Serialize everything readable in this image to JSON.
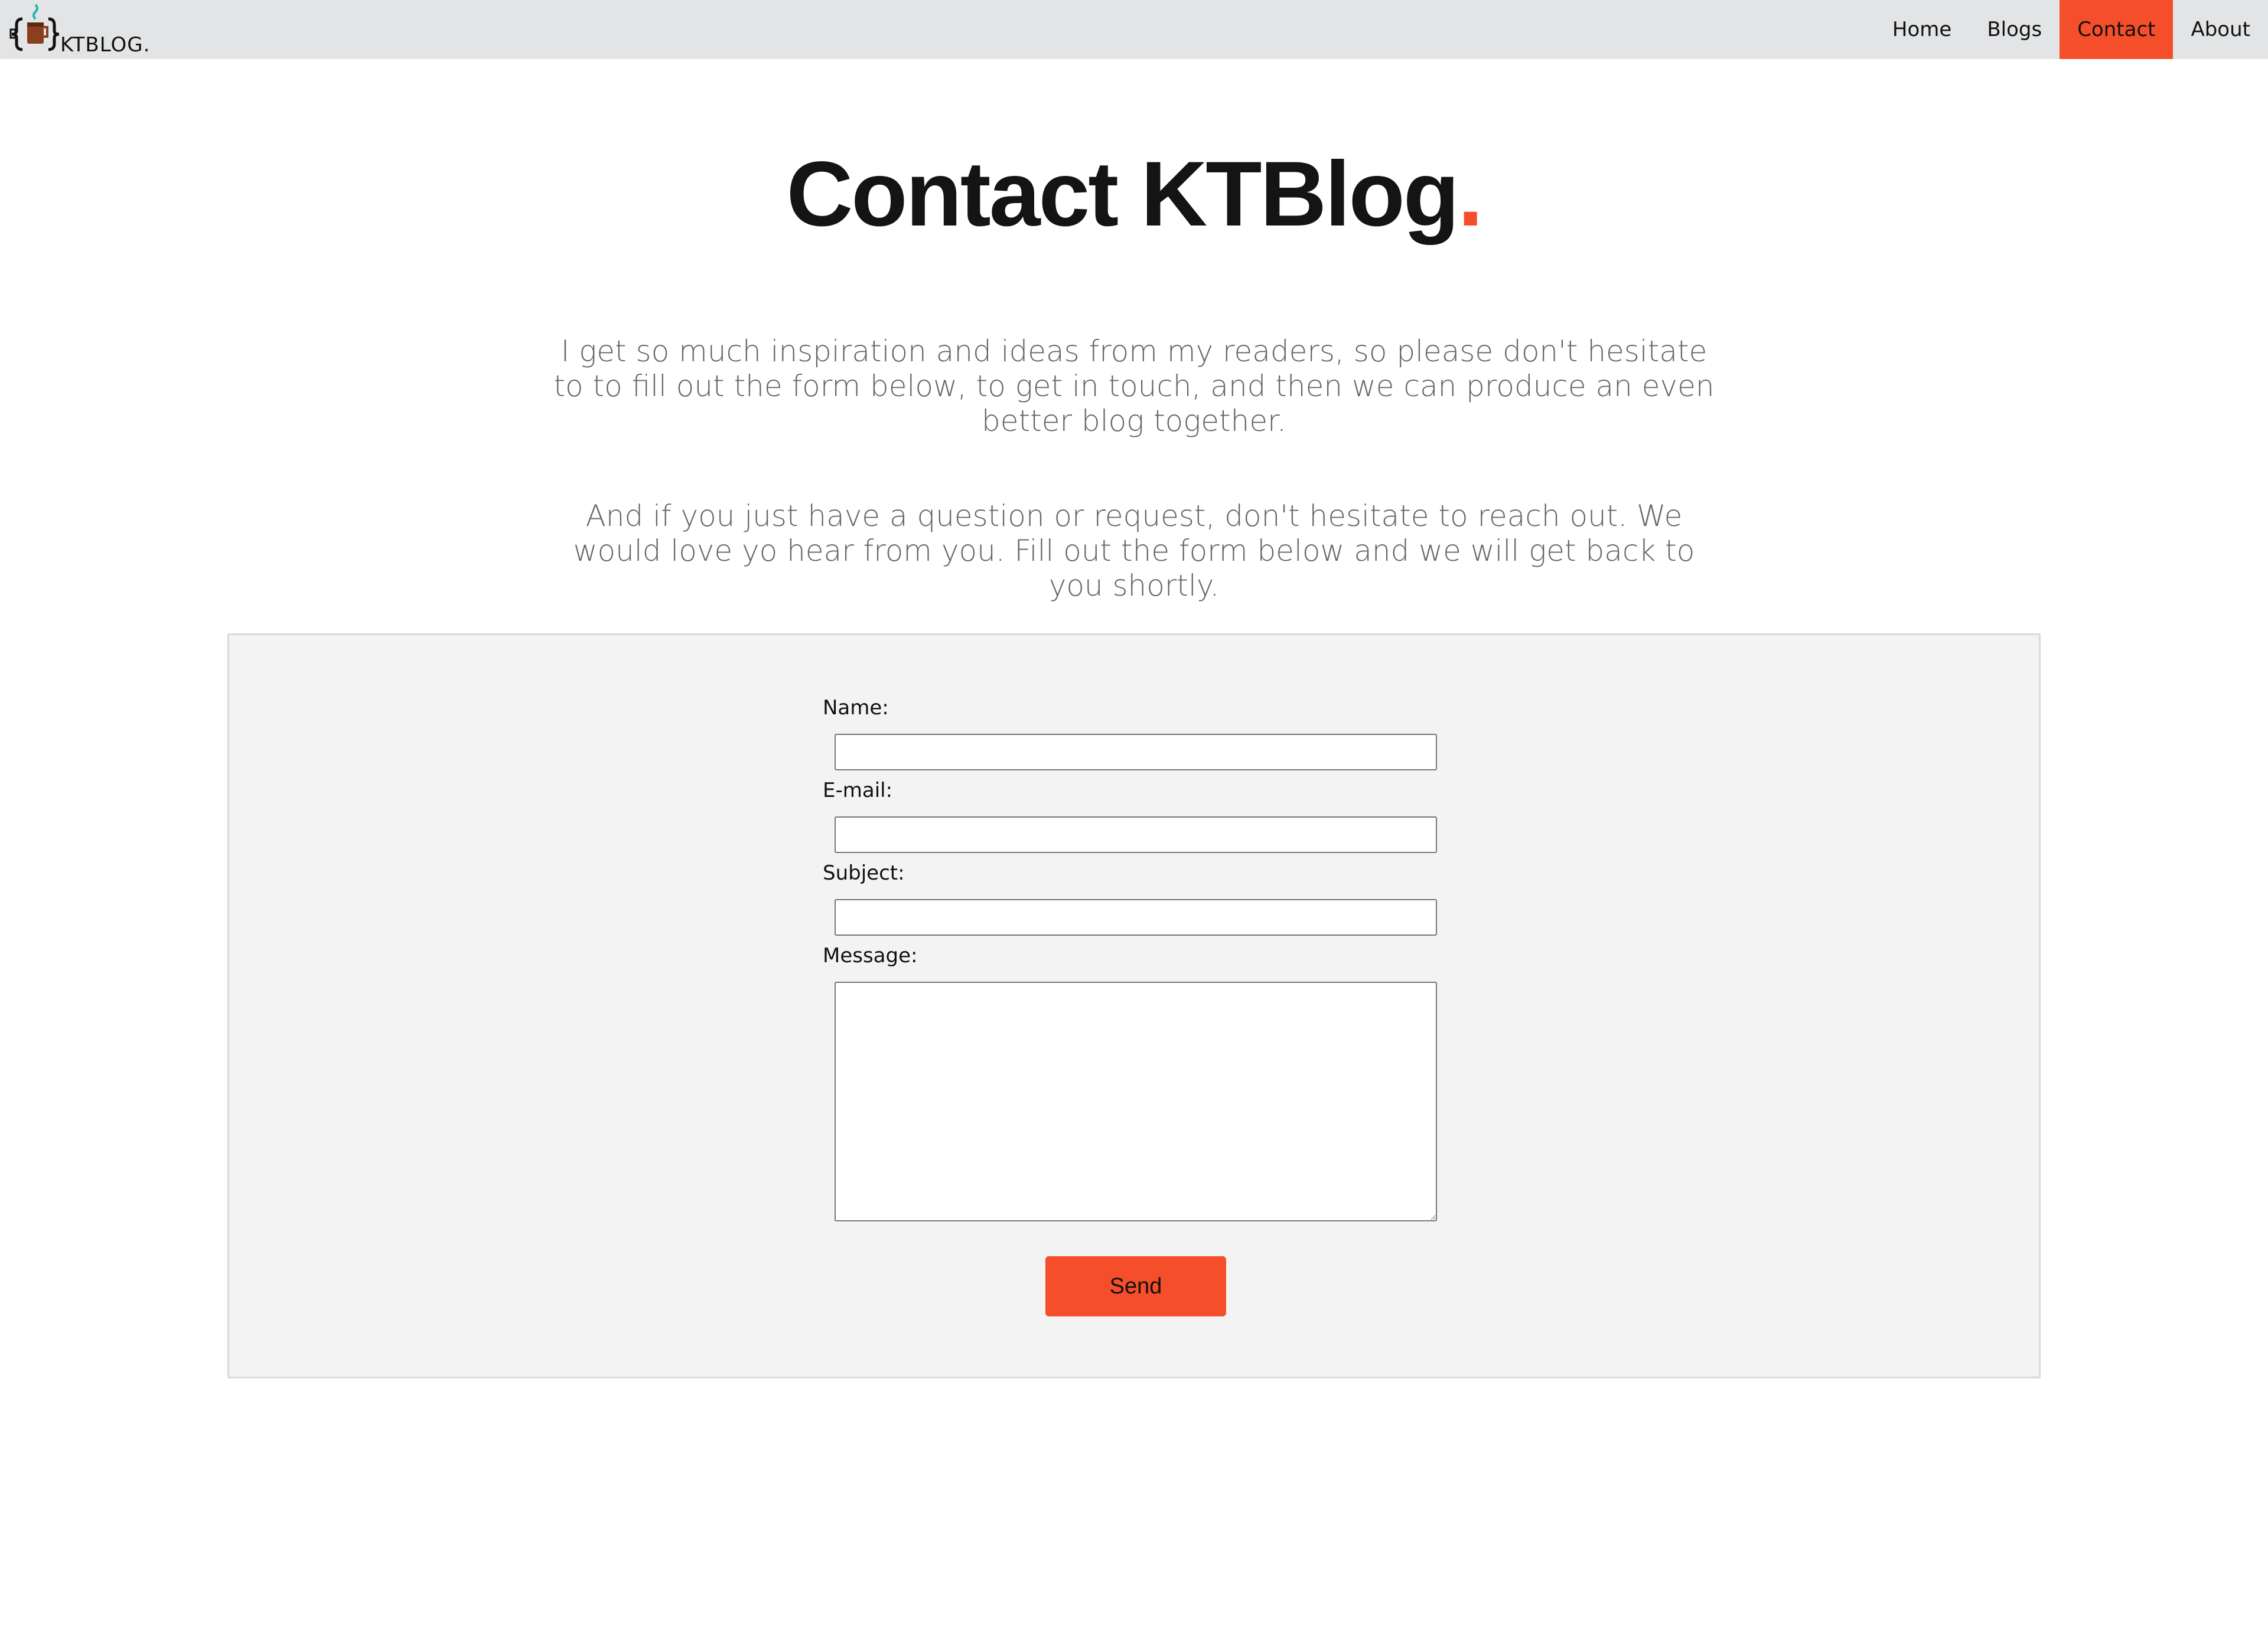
{
  "brand": {
    "name": "KTBLOG.",
    "accent_color": "#f54e2a",
    "logo_icon": "coffee-mug-braces-icon"
  },
  "nav": {
    "items": [
      {
        "label": "Home",
        "active": false
      },
      {
        "label": "Blogs",
        "active": false
      },
      {
        "label": "Contact",
        "active": true
      },
      {
        "label": "About",
        "active": false
      }
    ]
  },
  "header": {
    "title": "Contact KTBlog",
    "title_dot": "."
  },
  "intro": {
    "paragraph_1": "I get so much inspiration and ideas from my readers, so please don't hesitate to to fill out the form below, to get in touch, and then we can produce an even better blog together.",
    "paragraph_2": "And if you just have a question or request, don't hesitate to reach out. We would love yo hear from you. Fill out the form below and we will get back to you shortly."
  },
  "form": {
    "name_label": "Name:",
    "name_value": "",
    "email_label": "E-mail:",
    "email_value": "",
    "subject_label": "Subject:",
    "subject_value": "",
    "message_label": "Message:",
    "message_value": "",
    "submit_label": "Send"
  }
}
